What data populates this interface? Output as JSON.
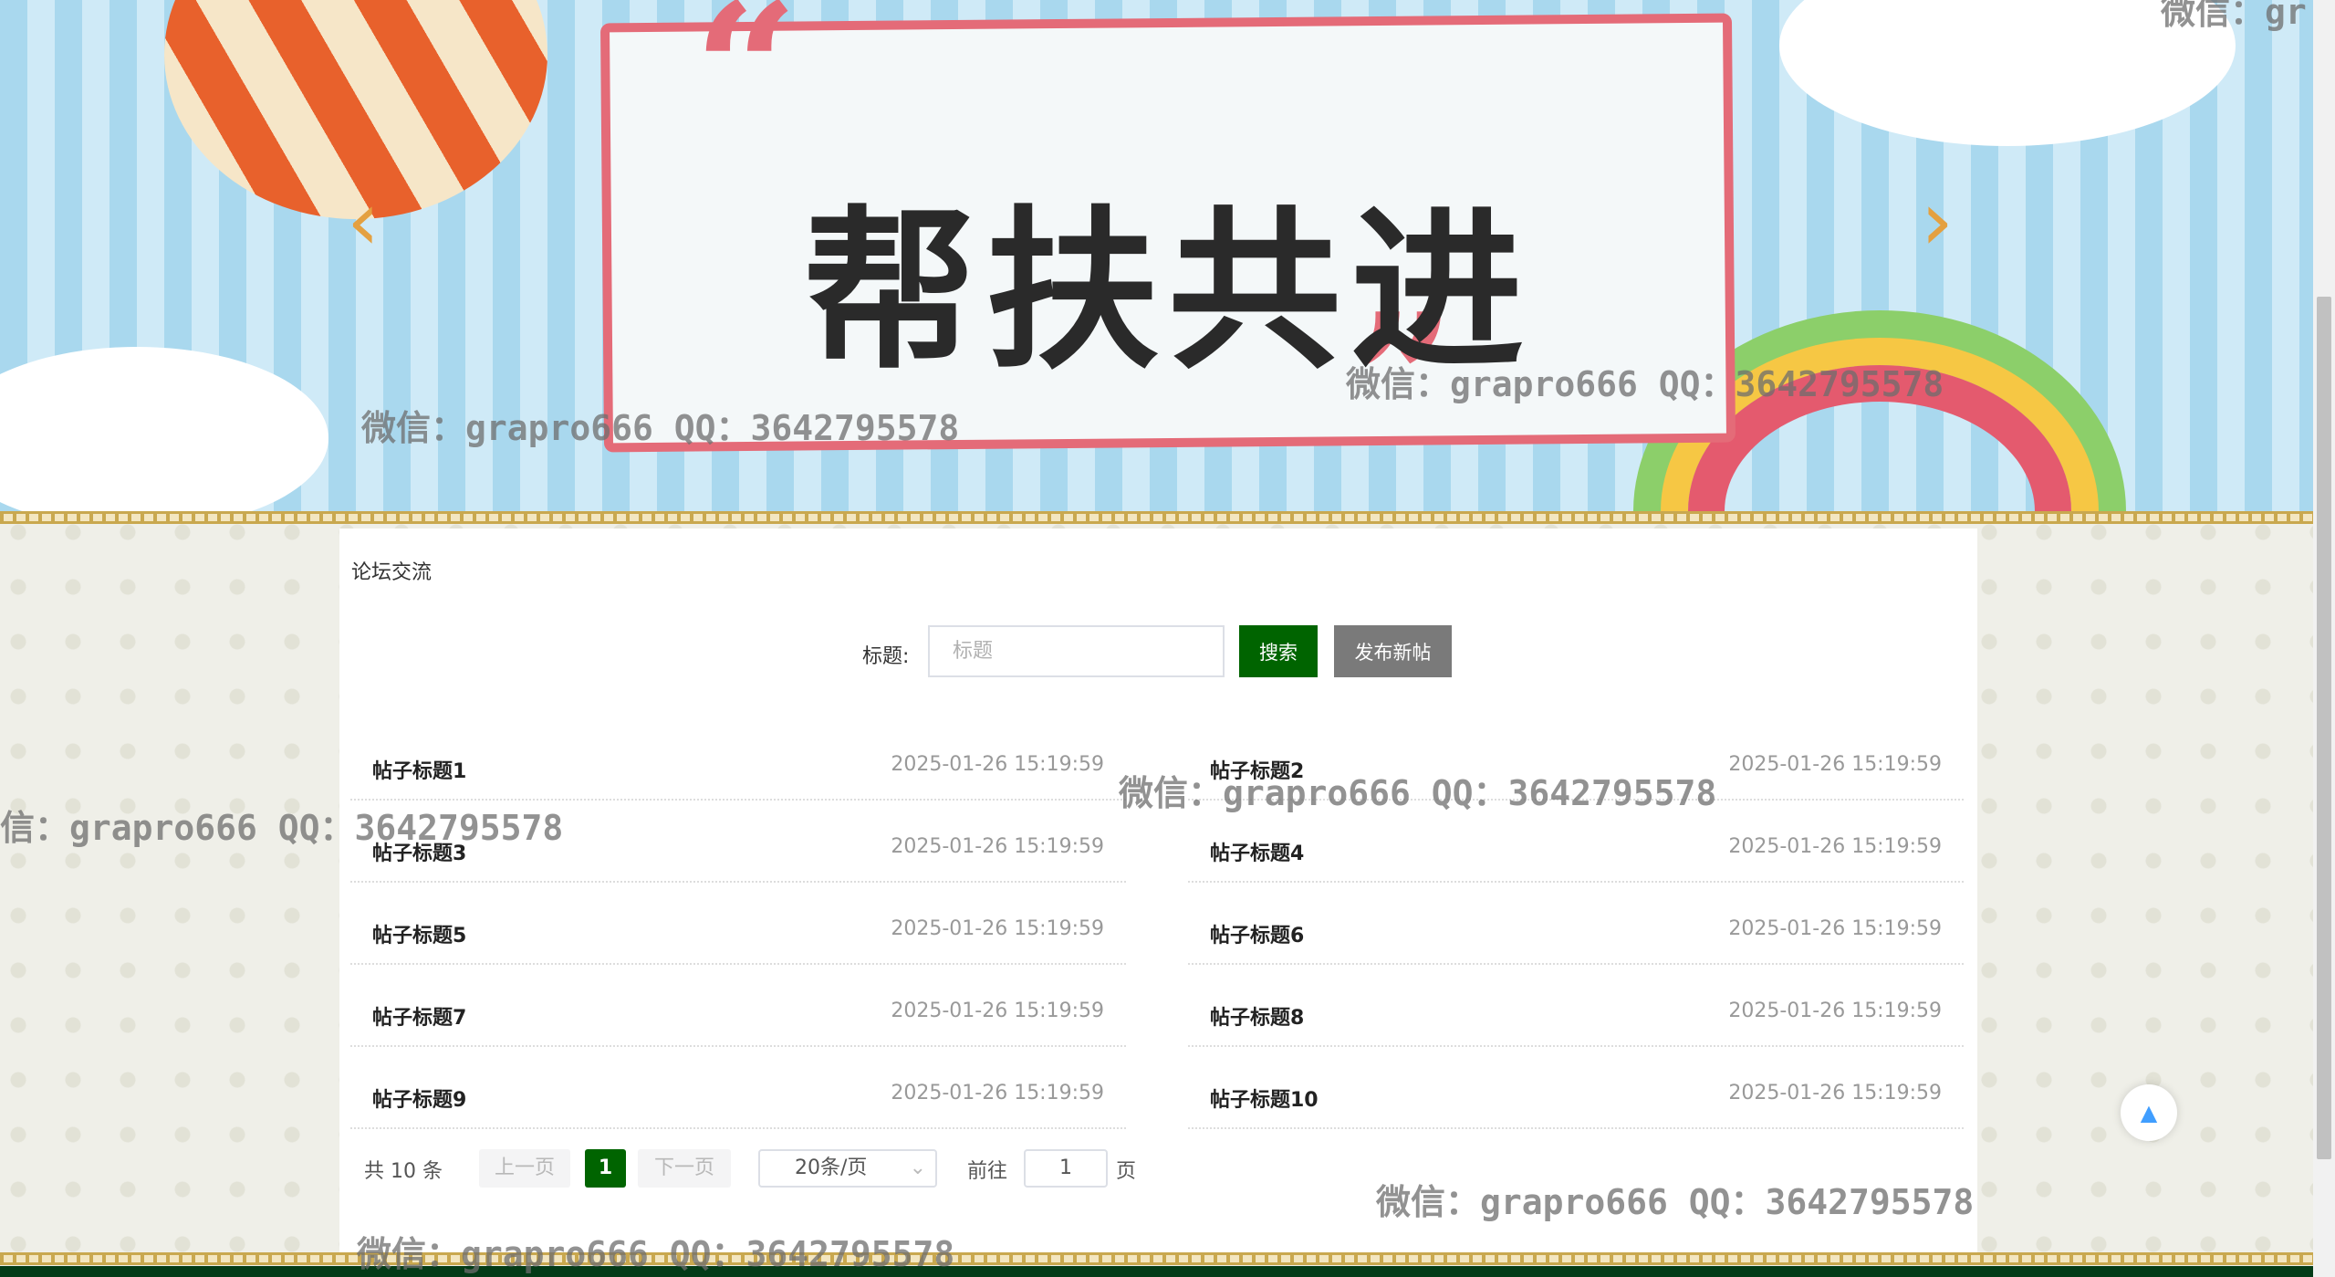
{
  "banner": {
    "title": "帮扶共进",
    "prev_icon": "chevron-left-icon",
    "next_icon": "chevron-right-icon"
  },
  "section": {
    "title": "论坛交流"
  },
  "search": {
    "label": "标题:",
    "placeholder": "标题",
    "value": "",
    "search_button": "搜索",
    "publish_button": "发布新帖"
  },
  "posts": [
    {
      "title": "帖子标题1",
      "date": "2025-01-26 15:19:59"
    },
    {
      "title": "帖子标题2",
      "date": "2025-01-26 15:19:59"
    },
    {
      "title": "帖子标题3",
      "date": "2025-01-26 15:19:59"
    },
    {
      "title": "帖子标题4",
      "date": "2025-01-26 15:19:59"
    },
    {
      "title": "帖子标题5",
      "date": "2025-01-26 15:19:59"
    },
    {
      "title": "帖子标题6",
      "date": "2025-01-26 15:19:59"
    },
    {
      "title": "帖子标题7",
      "date": "2025-01-26 15:19:59"
    },
    {
      "title": "帖子标题8",
      "date": "2025-01-26 15:19:59"
    },
    {
      "title": "帖子标题9",
      "date": "2025-01-26 15:19:59"
    },
    {
      "title": "帖子标题10",
      "date": "2025-01-26 15:19:59"
    }
  ],
  "pagination": {
    "total": "共 10 条",
    "prev": "上一页",
    "current": "1",
    "next": "下一页",
    "page_size": "20条/页",
    "goto_label": "前往",
    "goto_value": "1",
    "goto_suffix": "页"
  },
  "watermark": "微信：grapro666 QQ：3642795578",
  "watermark_cut_left": "信：grapro666 QQ：3642795578",
  "watermark_cut_top": "微信：gr",
  "colors": {
    "primary": "#006400",
    "secondary": "#7a7a7a",
    "footer": "#033b17"
  }
}
